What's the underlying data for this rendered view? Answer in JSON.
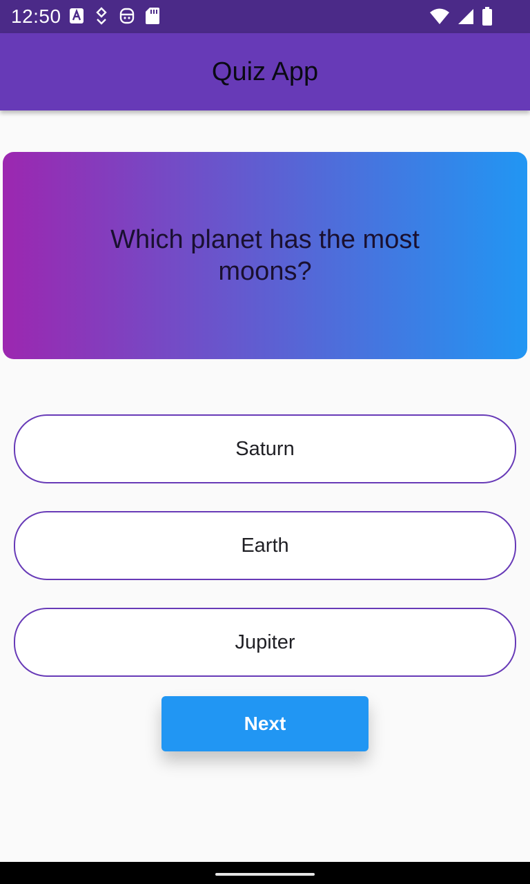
{
  "status_bar": {
    "time": "12:50",
    "left_icons": [
      "text-a-icon",
      "location-drop-icon",
      "robot-face-icon",
      "sd-card-icon"
    ],
    "right_icons": [
      "wifi-icon",
      "signal-icon",
      "battery-icon"
    ]
  },
  "app_bar": {
    "title": "Quiz App"
  },
  "question": {
    "text": "Which planet has the most moons?"
  },
  "answers": [
    {
      "label": "Saturn"
    },
    {
      "label": "Earth"
    },
    {
      "label": "Jupiter"
    }
  ],
  "next_button": {
    "label": "Next"
  },
  "colors": {
    "status_bar": "#4b2a88",
    "app_bar": "#673ab7",
    "gradient_start": "#9c27b0",
    "gradient_end": "#2196f3",
    "answer_border": "#673ab7",
    "next_button": "#2196f3"
  }
}
